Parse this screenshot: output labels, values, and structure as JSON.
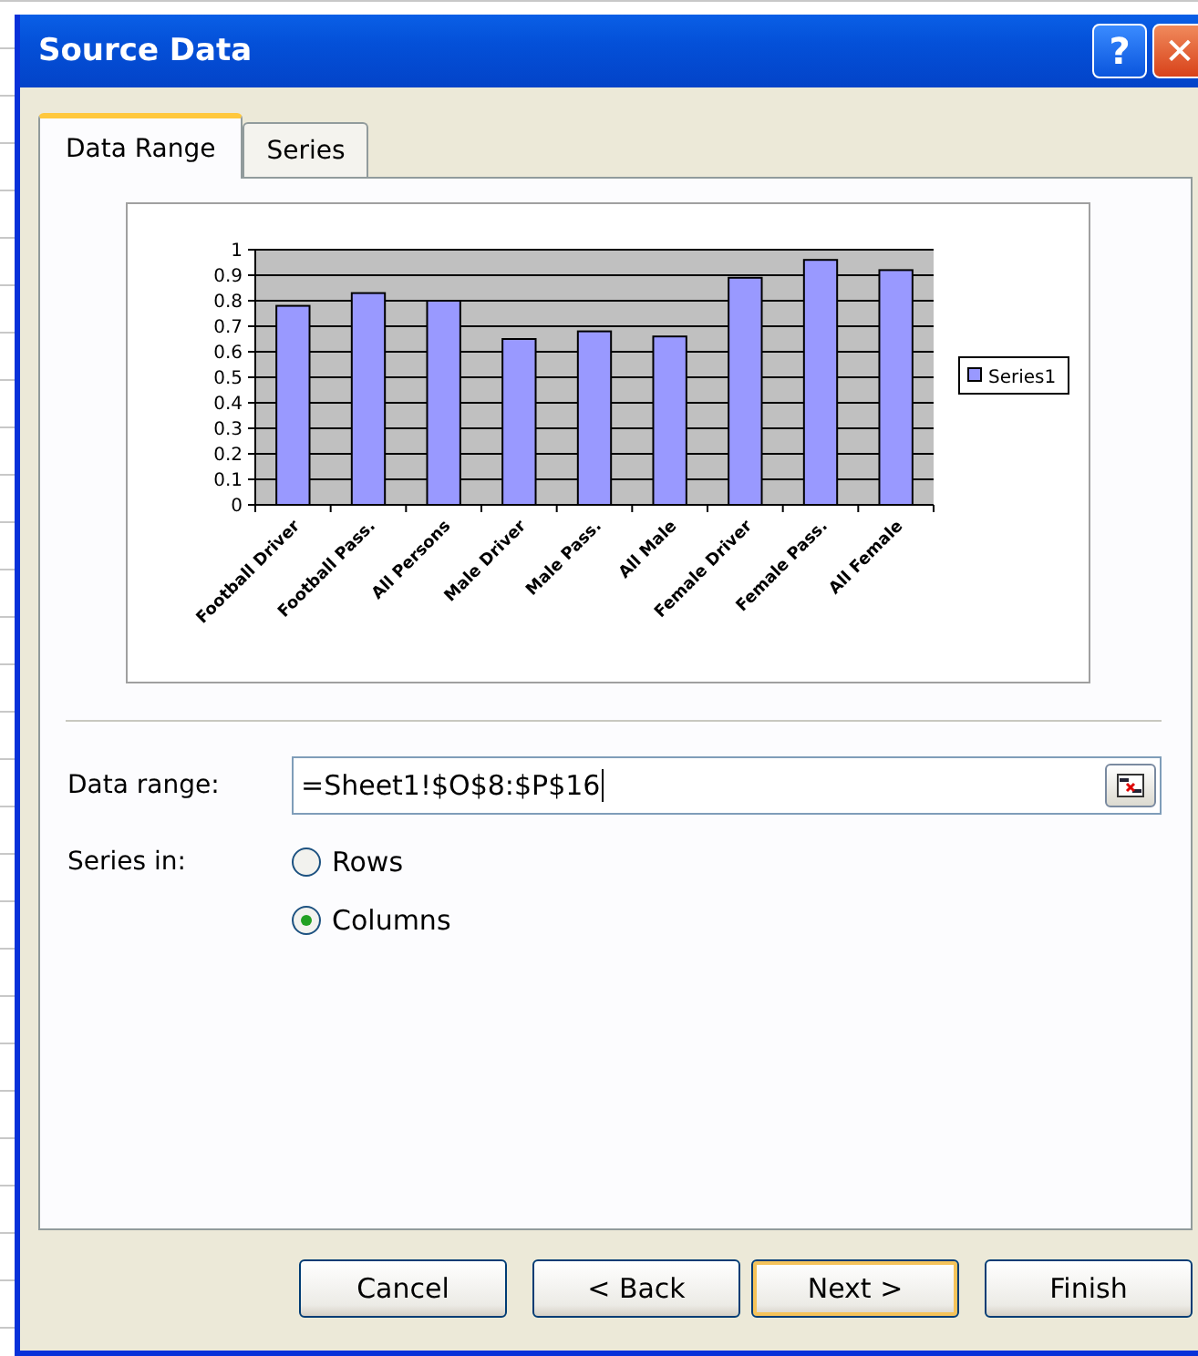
{
  "window": {
    "title": "Source Data",
    "title_buttons": [
      "?",
      "✕"
    ]
  },
  "tabs": [
    {
      "label": "Data Range",
      "selected": true
    },
    {
      "label": "Series",
      "selected": false
    }
  ],
  "chart_data": {
    "type": "bar",
    "categories": [
      "Football Driver",
      "Football Pass.",
      "All Persons",
      "Male Driver",
      "Male Pass.",
      "All Male",
      "Female Driver",
      "Female Pass.",
      "All Female"
    ],
    "series": [
      {
        "name": "Series1",
        "color": "#9999ff",
        "values": [
          0.78,
          0.83,
          0.8,
          0.65,
          0.68,
          0.66,
          0.89,
          0.96,
          0.92
        ]
      }
    ],
    "grid": true,
    "ylim": [
      0,
      1
    ],
    "yticks": [
      0,
      0.1,
      0.2,
      0.3,
      0.4,
      0.5,
      0.6,
      0.7,
      0.8,
      0.9,
      {
        "value": 1,
        "label": "1"
      }
    ]
  },
  "data_range": {
    "label": "Data range:",
    "value": "=Sheet1!$O$8:$P$16"
  },
  "series_in": {
    "label": "Series in:",
    "options": [
      {
        "label": "Rows",
        "selected": false
      },
      {
        "label": "Columns",
        "selected": true
      }
    ]
  },
  "buttons": [
    {
      "label": "Cancel",
      "default": false
    },
    {
      "label": "< Back",
      "default": false
    },
    {
      "label": "Next >",
      "default": true
    },
    {
      "label": "Finish",
      "default": false
    }
  ]
}
